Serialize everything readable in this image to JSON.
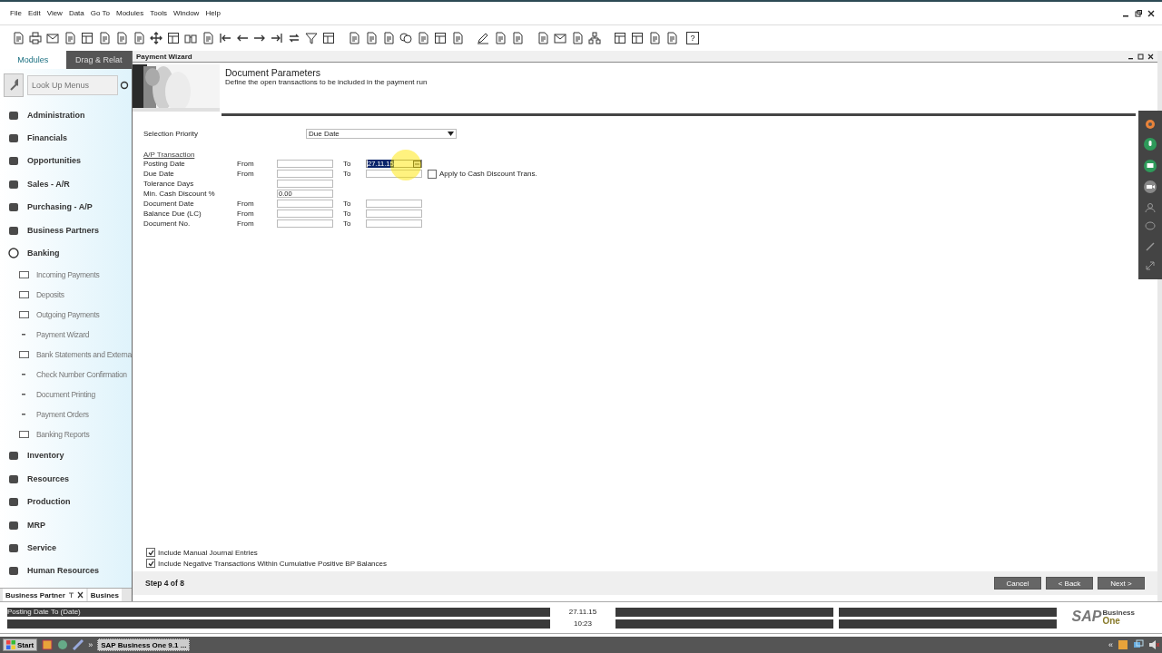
{
  "menu": [
    "File",
    "Edit",
    "View",
    "Data",
    "Go To",
    "Modules",
    "Tools",
    "Window",
    "Help"
  ],
  "toolbar": {
    "help_label": "?"
  },
  "sidebar": {
    "tabs": [
      {
        "label": "Modules",
        "selected": true
      },
      {
        "label": "Drag & Relat",
        "selected": false
      }
    ],
    "search": {
      "placeholder": "Look Up Menus"
    },
    "items": [
      {
        "label": "Administration",
        "expanded": false
      },
      {
        "label": "Financials",
        "expanded": false
      },
      {
        "label": "Opportunities",
        "expanded": false
      },
      {
        "label": "Sales - A/R",
        "expanded": false
      },
      {
        "label": "Purchasing - A/P",
        "expanded": false
      },
      {
        "label": "Business Partners",
        "expanded": false
      },
      {
        "label": "Banking",
        "expanded": true,
        "children": [
          {
            "label": "Incoming Payments",
            "kind": "folder"
          },
          {
            "label": "Deposits",
            "kind": "folder"
          },
          {
            "label": "Outgoing Payments",
            "kind": "folder"
          },
          {
            "label": "Payment Wizard",
            "kind": "form"
          },
          {
            "label": "Bank Statements and Externa",
            "kind": "folder"
          },
          {
            "label": "Check Number Confirmation",
            "kind": "form"
          },
          {
            "label": "Document Printing",
            "kind": "form"
          },
          {
            "label": "Payment Orders",
            "kind": "form"
          },
          {
            "label": "Banking Reports",
            "kind": "folder"
          }
        ]
      },
      {
        "label": "Inventory",
        "expanded": false
      },
      {
        "label": "Resources",
        "expanded": false
      },
      {
        "label": "Production",
        "expanded": false
      },
      {
        "label": "MRP",
        "expanded": false
      },
      {
        "label": "Service",
        "expanded": false
      },
      {
        "label": "Human Resources",
        "expanded": false
      }
    ],
    "bottom_tabs": [
      {
        "label": "Business Partner",
        "selected": true
      },
      {
        "label": "Busines",
        "selected": false
      }
    ]
  },
  "wizard": {
    "title": "Payment Wizard",
    "heading": "Document Parameters",
    "subheading": "Define the open transactions to be included in the payment run",
    "selection_priority": {
      "label": "Selection Priority",
      "value": "Due Date"
    },
    "section": "A/P Transaction",
    "rows": [
      {
        "kind": "range",
        "label": "Posting Date",
        "from": "From",
        "to": "To",
        "to_value": "27.11.15",
        "to_selected": true
      },
      {
        "kind": "range",
        "label": "Due Date",
        "from": "From",
        "to": "To",
        "to_selected": false,
        "checkbox": {
          "label": "Apply to Cash Discount Trans.",
          "checked": false
        }
      },
      {
        "kind": "single",
        "label": "Tolerance Days"
      },
      {
        "kind": "single",
        "label": "Min. Cash Discount %",
        "value": "0.00"
      },
      {
        "kind": "range",
        "label": "Document Date",
        "from": "From",
        "to": "To",
        "to_selected": false
      },
      {
        "kind": "range",
        "label": "Balance Due (LC)",
        "from": "From",
        "to": "To",
        "to_selected": false
      },
      {
        "kind": "range",
        "label": "Document No.",
        "from": "From",
        "to": "To",
        "to_selected": false
      }
    ],
    "options": [
      {
        "label": "Include Manual Journal Entries",
        "checked": true
      },
      {
        "label": "Include Negative Transactions Within Cumulative Positive BP Balances",
        "checked": true
      }
    ],
    "step": "Step 4 of 8",
    "buttons": [
      "Cancel",
      "< Back",
      "Next >"
    ]
  },
  "status_bar": {
    "message": "Posting Date To (Date)",
    "date": "27.11.15",
    "time": "10:23",
    "logo": "SAP",
    "logo_sub": "Business",
    "logo_main": "One"
  },
  "taskbar": {
    "start": "Start",
    "more": "»",
    "task": "SAP Business One 9.1 ...",
    "tray_more": "«"
  }
}
